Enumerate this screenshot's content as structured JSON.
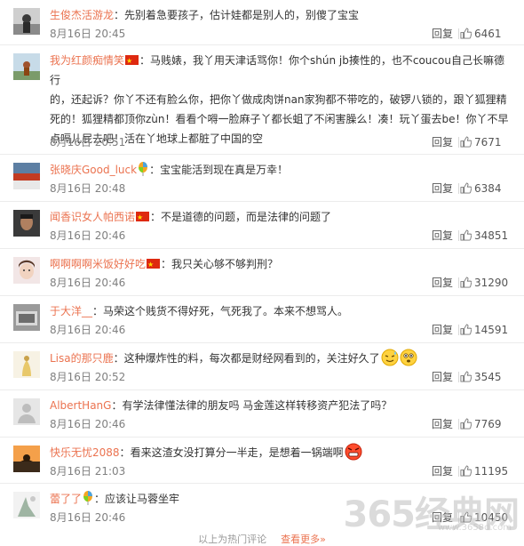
{
  "comments": [
    {
      "user": "生俊杰活游龙",
      "sep": "：",
      "text": "先别着急要孩子，估计娃都是别人的，别傻了宝宝",
      "time": "8月16日 20:45",
      "reply": "回复",
      "likes": "6461"
    },
    {
      "user": "我为红颜痴情笑",
      "sep": "：",
      "text_l1": "马贱婊，我丫用天津话骂你！你个shún jb揍性的，也不coucou自己长嘛德行",
      "text_l2": "的，还起诉？你丫不还有脸么你，把你丫做成肉饼nan家狗都不带吃的，破锣八锁的，跟丫狐狸精",
      "text_l3": "死的！狐狸精都顶你zùn！看看个嘚一脸麻子丫都长蛆了不闲害臊么！凑！玩丫蛋去be！你丫不早",
      "text_l4": "点嗝儿屁去吧！活在丫地球上都脏了中国的空",
      "time": "8月16日 20:51",
      "reply": "回复",
      "likes": "7671"
    },
    {
      "user": "张晓庆Good_luck",
      "sep": "：",
      "text": "宝宝能活到现在真是万幸！",
      "time": "8月16日 20:48",
      "reply": "回复",
      "likes": "6384"
    },
    {
      "user": "闻香识女人帕西诺",
      "sep": "：",
      "text": "不是道德的问题，而是法律的问题了",
      "time": "8月16日 20:46",
      "reply": "回复",
      "likes": "34851"
    },
    {
      "user": "啊啊啊啊米饭好好吃",
      "sep": "：",
      "text": "我只关心够不够判刑？",
      "time": "8月16日 20:46",
      "reply": "回复",
      "likes": "31290"
    },
    {
      "user": "于大洋__",
      "sep": "：",
      "text": "马荣这个贱货不得好死，气死我了。本来不想骂人。",
      "time": "8月16日 20:46",
      "reply": "回复",
      "likes": "14591"
    },
    {
      "user": "Lisa的那只鹿",
      "sep": "：",
      "text": "这种爆炸性的料，每次都是财经网看到的，关注好久了",
      "time": "8月16日 20:52",
      "reply": "回复",
      "likes": "3545"
    },
    {
      "user": "AlbertHanG",
      "sep": "：",
      "text": "有学法律懂法律的朋友吗 马金莲这样转移资产犯法了吗？",
      "time": "8月16日 20:46",
      "reply": "回复",
      "likes": "7769"
    },
    {
      "user": "快乐无忧2088",
      "sep": "：",
      "text": "看来这渣女没打算分一半走，是想着一锅端啊",
      "time": "8月16日 21:03",
      "reply": "回复",
      "likes": "11195"
    },
    {
      "user": "蕾了了",
      "sep": "：",
      "text": "应该让马蓉坐牢",
      "time": "8月16日 20:46",
      "reply": "回复",
      "likes": "10450"
    }
  ],
  "footer": {
    "text": "以上为热门评论",
    "more": "查看更多»"
  },
  "watermark": {
    "text": "365经典网",
    "sub": "www.3658d.com"
  },
  "colors": {
    "username": "#eb7350",
    "time": "#808080",
    "flag": "#de2910"
  }
}
